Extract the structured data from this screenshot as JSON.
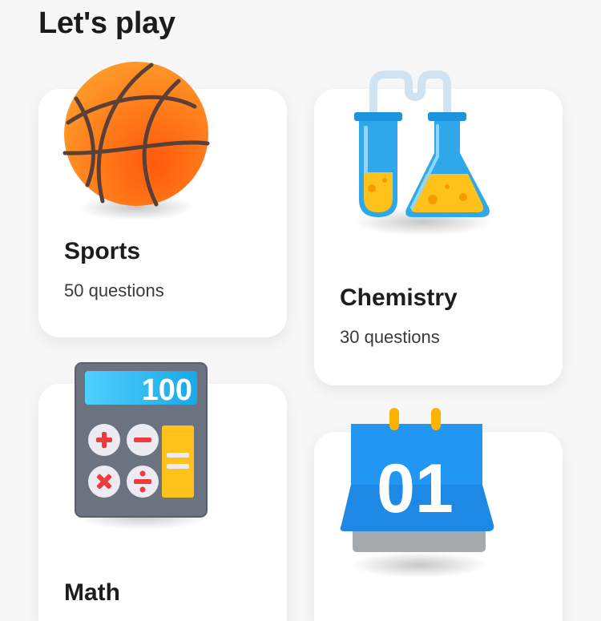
{
  "header": {
    "title": "Let's play"
  },
  "categories": [
    {
      "name": "Sports",
      "count": "50 questions",
      "icon": "basketball-icon"
    },
    {
      "name": "Chemistry",
      "count": "30 questions",
      "icon": "lab-flasks-icon"
    },
    {
      "name": "Math",
      "count": "",
      "icon": "calculator-icon",
      "display_value": "100"
    },
    {
      "name": "",
      "count": "",
      "icon": "calendar-icon",
      "display_value": "01"
    }
  ],
  "colors": {
    "background": "#f7f7f7",
    "card": "#ffffff",
    "basketball": "#ff7a1a",
    "flask_blue": "#2ea8ea",
    "liquid": "#ffc21a",
    "calendar_blue": "#1e88e5",
    "calculator_body": "#6b7280"
  }
}
